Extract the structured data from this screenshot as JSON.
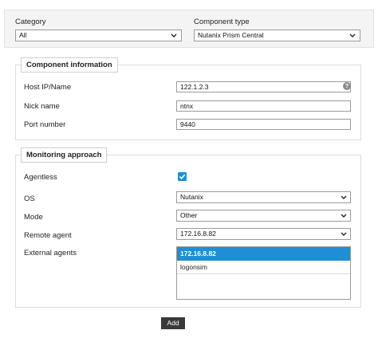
{
  "filters": {
    "category_label": "Category",
    "category_value": "All",
    "component_type_label": "Component type",
    "component_type_value": "Nutanix Prism Central"
  },
  "component_info": {
    "legend": "Component information",
    "host_label": "Host IP/Name",
    "host_value": "122.1.2.3",
    "help_glyph": "?",
    "nick_label": "Nick name",
    "nick_value": "ntnx",
    "port_label": "Port number",
    "port_value": "9440"
  },
  "monitoring": {
    "legend": "Monitoring approach",
    "agentless_label": "Agentless",
    "agentless_checked": true,
    "os_label": "OS",
    "os_value": "Nutanix",
    "mode_label": "Mode",
    "mode_value": "Other",
    "remote_agent_label": "Remote agent",
    "remote_agent_value": "172.16.8.82",
    "external_agents_label": "External agents",
    "external_agents": [
      {
        "label": "172.16.8.82",
        "selected": true
      },
      {
        "label": "logonsim",
        "selected": false
      }
    ]
  },
  "actions": {
    "add_label": "Add"
  },
  "colors": {
    "accent": "#1e8fd5",
    "button_bg": "#3a3a3a"
  },
  "icons": [
    "chevron-down-icon",
    "help-icon",
    "checkmark-icon"
  ]
}
